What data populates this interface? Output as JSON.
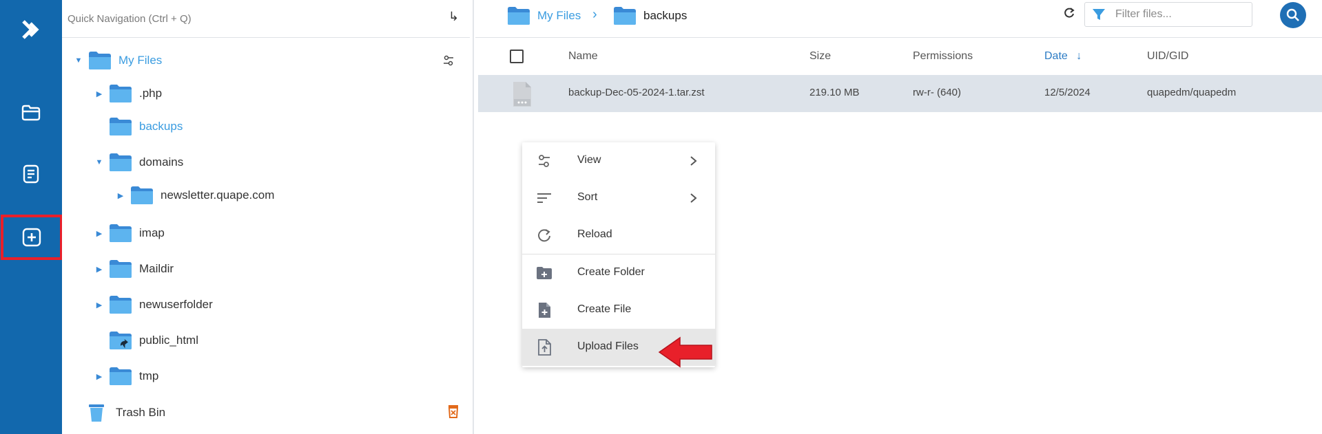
{
  "quick_nav": {
    "placeholder": "Quick Navigation (Ctrl + Q)"
  },
  "tree": {
    "root": "My Files",
    "items": [
      {
        "label": ".php"
      },
      {
        "label": "backups"
      },
      {
        "label": "domains"
      },
      {
        "label": "newsletter.quape.com"
      },
      {
        "label": "imap"
      },
      {
        "label": "Maildir"
      },
      {
        "label": "newuserfolder"
      },
      {
        "label": "public_html"
      },
      {
        "label": "tmp"
      }
    ],
    "trash": "Trash Bin"
  },
  "breadcrumb": {
    "root": "My Files",
    "current": "backups"
  },
  "filter": {
    "placeholder": "Filter files..."
  },
  "table": {
    "headers": {
      "name": "Name",
      "size": "Size",
      "permissions": "Permissions",
      "date": "Date",
      "uid": "UID/GID"
    },
    "rows": [
      {
        "name": "backup-Dec-05-2024-1.tar.zst",
        "size": "219.10 MB",
        "permissions": "rw-r- (640)",
        "date": "12/5/2024",
        "uid": "quapedm/quapedm"
      }
    ]
  },
  "context_menu": {
    "view": "View",
    "sort": "Sort",
    "reload": "Reload",
    "create_folder": "Create Folder",
    "create_file": "Create File",
    "upload_files": "Upload Files"
  },
  "colors": {
    "rail": "#1268ad",
    "accent": "#3a9ce0",
    "highlight": "#e8202a",
    "folder": "#5db4ef"
  }
}
